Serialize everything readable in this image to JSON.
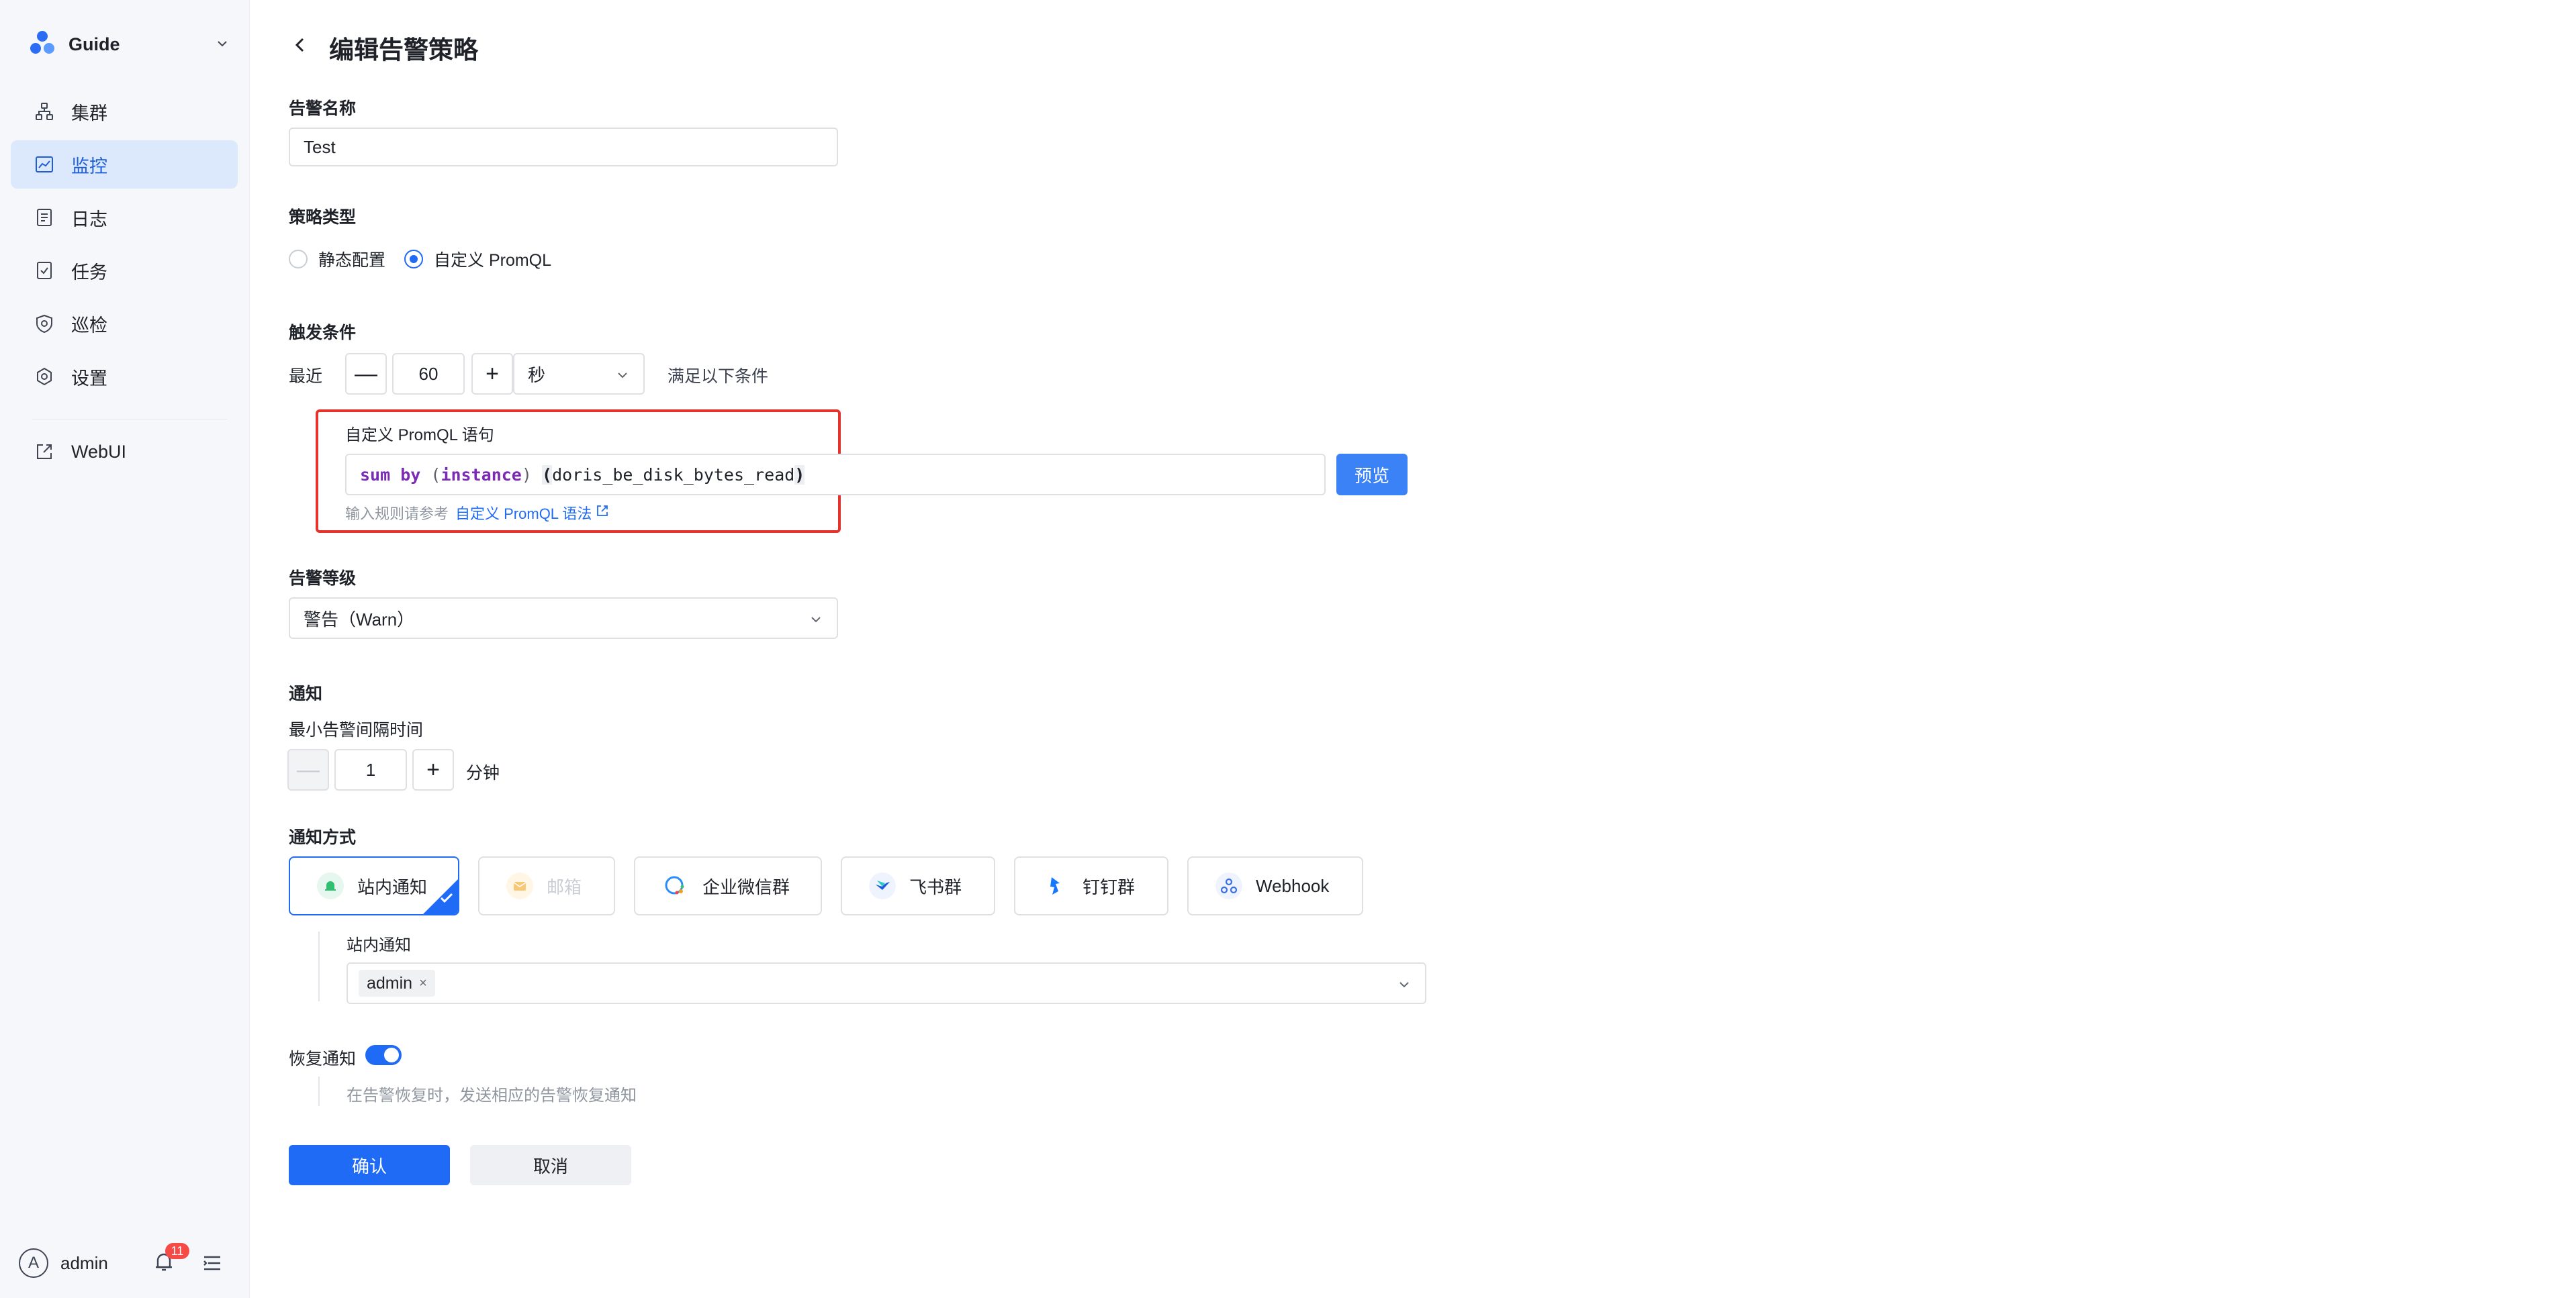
{
  "sidebar": {
    "brand": "Guide",
    "items": [
      {
        "label": "集群",
        "icon": "cluster-icon"
      },
      {
        "label": "监控",
        "icon": "monitor-chart-icon",
        "active": true
      },
      {
        "label": "日志",
        "icon": "log-document-icon"
      },
      {
        "label": "任务",
        "icon": "task-bookmark-icon"
      },
      {
        "label": "巡检",
        "icon": "inspection-shield-icon"
      },
      {
        "label": "设置",
        "icon": "settings-gear-icon"
      }
    ],
    "external": {
      "label": "WebUI",
      "icon": "external-link-icon"
    },
    "user": {
      "initial": "A",
      "name": "admin"
    },
    "notification_count": "11"
  },
  "page": {
    "title": "编辑告警策略"
  },
  "form": {
    "name": {
      "label": "告警名称",
      "value": "Test"
    },
    "strategy": {
      "label": "策略类型",
      "options": [
        "静态配置",
        "自定义 PromQL"
      ],
      "selected": "自定义 PromQL"
    },
    "trigger": {
      "label": "触发条件",
      "prefix": "最近",
      "minus": "—",
      "value": "60",
      "plus": "+",
      "unit": "秒",
      "suffix": "满足以下条件"
    },
    "promql": {
      "label": "自定义 PromQL 语句",
      "kw_sum": "sum",
      "kw_by": "by",
      "open_paren": "(",
      "group_var": "instance",
      "close_paren": ")",
      "open_bracket": "(",
      "metric": "doris_be_disk_bytes_read",
      "close_bracket": ")",
      "preview_button": "预览",
      "help_text": "输入规则请参考",
      "help_link": "自定义 PromQL 语法"
    },
    "level": {
      "label": "告警等级",
      "value": "警告（Warn）"
    },
    "notify": {
      "label": "通知",
      "interval_label": "最小告警间隔时间",
      "minus": "—",
      "interval_value": "1",
      "plus": "+",
      "interval_unit": "分钟"
    },
    "channels": {
      "label": "通知方式",
      "items": [
        {
          "label": "站内通知",
          "icon": "bell-icon",
          "selected": true
        },
        {
          "label": "邮箱",
          "icon": "mail-icon",
          "disabled": true
        },
        {
          "label": "企业微信群",
          "icon": "wecom-icon"
        },
        {
          "label": "飞书群",
          "icon": "feishu-icon"
        },
        {
          "label": "钉钉群",
          "icon": "dingtalk-icon"
        },
        {
          "label": "Webhook",
          "icon": "webhook-icon"
        }
      ],
      "site_label": "站内通知",
      "recipients": [
        "admin"
      ]
    },
    "recovery": {
      "label": "恢复通知",
      "enabled": true,
      "desc": "在告警恢复时，发送相应的告警恢复通知"
    }
  },
  "actions": {
    "confirm": "确认",
    "cancel": "取消"
  },
  "colors": {
    "primary": "#1f6bf5",
    "highlight": "#e5322d",
    "sidebar_bg": "#f5f7fb"
  }
}
